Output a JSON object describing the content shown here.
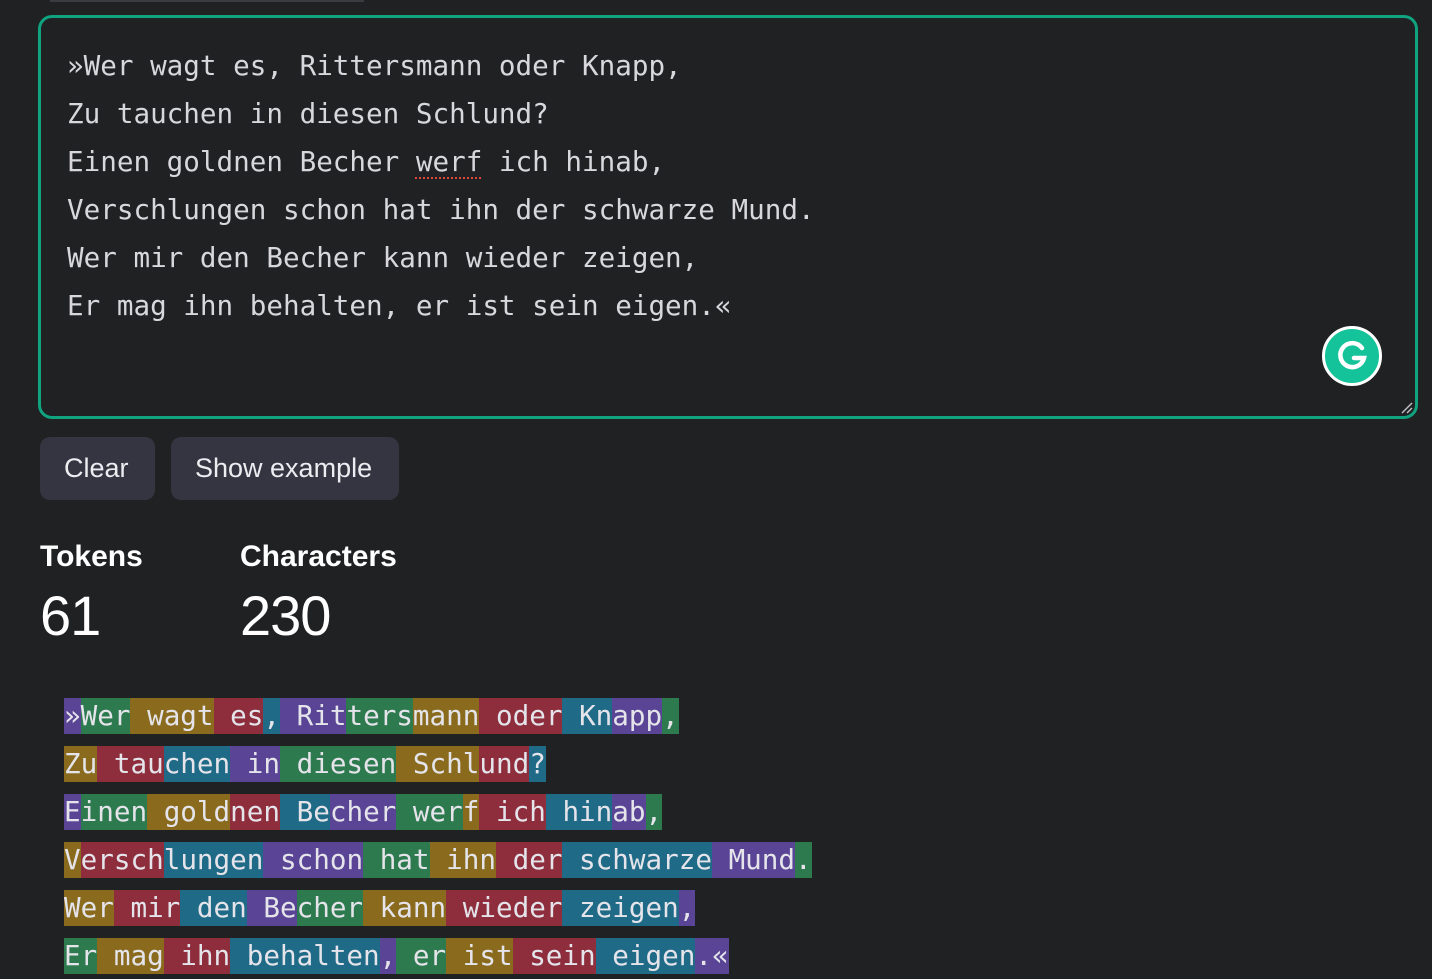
{
  "input": {
    "lines": [
      "»Wer wagt es, Rittersmann oder Knapp,",
      "Zu tauchen in diesen Schlund?",
      "Einen goldnen Becher werf ich hinab,",
      "Verschlungen schon hat ihn der schwarze Mund.",
      "Wer mir den Becher kann wieder zeigen,",
      "Er mag ihn behalten, er ist sein eigen.«"
    ],
    "line3_parts": {
      "before": "Einen goldnen Becher ",
      "misspelled": "werf",
      "after": " ich hinab,"
    }
  },
  "buttons": {
    "clear_label": "Clear",
    "example_label": "Show example"
  },
  "stats": {
    "tokens_label": "Tokens",
    "tokens_value": "61",
    "characters_label": "Characters",
    "characters_value": "230"
  },
  "colors": {
    "accent": "#10a37f",
    "background": "#202123",
    "button_bg": "#343541",
    "grammarly": "#15c39a"
  },
  "token_lines": [
    [
      [
        "»",
        0
      ],
      [
        "Wer",
        1
      ],
      [
        " wag",
        2
      ],
      [
        "t",
        2
      ],
      [
        " es",
        3
      ],
      [
        ",",
        4
      ],
      [
        " Rit",
        0
      ],
      [
        "ters",
        1
      ],
      [
        "mann",
        2
      ],
      [
        " oder",
        3
      ],
      [
        " Kn",
        4
      ],
      [
        "app",
        0
      ],
      [
        ",",
        1
      ]
    ],
    [
      [
        "Zu",
        2
      ],
      [
        " tau",
        3
      ],
      [
        "chen",
        4
      ],
      [
        " in",
        0
      ],
      [
        " diesen",
        1
      ],
      [
        " Schl",
        2
      ],
      [
        "und",
        3
      ],
      [
        "?",
        4
      ]
    ],
    [
      [
        "E",
        0
      ],
      [
        "inen",
        1
      ],
      [
        " gold",
        2
      ],
      [
        "nen",
        3
      ],
      [
        " Be",
        4
      ],
      [
        "cher",
        0
      ],
      [
        " wer",
        1
      ],
      [
        "f",
        2
      ],
      [
        " ich",
        3
      ],
      [
        " hin",
        4
      ],
      [
        "ab",
        0
      ],
      [
        ",",
        1
      ]
    ],
    [
      [
        "V",
        2
      ],
      [
        "ersch",
        3
      ],
      [
        "lungen",
        4
      ],
      [
        " schon",
        0
      ],
      [
        " hat",
        1
      ],
      [
        " ihn",
        2
      ],
      [
        " der",
        3
      ],
      [
        " schwarze",
        4
      ],
      [
        " Mund",
        0
      ],
      [
        ".",
        1
      ]
    ],
    [
      [
        "Wer",
        2
      ],
      [
        " mir",
        3
      ],
      [
        " den",
        4
      ],
      [
        " Be",
        0
      ],
      [
        "cher",
        1
      ],
      [
        " kann",
        2
      ],
      [
        " wieder",
        3
      ],
      [
        " zeigen",
        4
      ],
      [
        ",",
        0
      ]
    ],
    [
      [
        "Er",
        1
      ],
      [
        " mag",
        2
      ],
      [
        " ihn",
        3
      ],
      [
        " behalten",
        4
      ],
      [
        ",",
        0
      ],
      [
        " er",
        1
      ],
      [
        " ist",
        2
      ],
      [
        " sein",
        3
      ],
      [
        " eigen",
        4
      ],
      [
        ".«",
        0
      ]
    ]
  ]
}
